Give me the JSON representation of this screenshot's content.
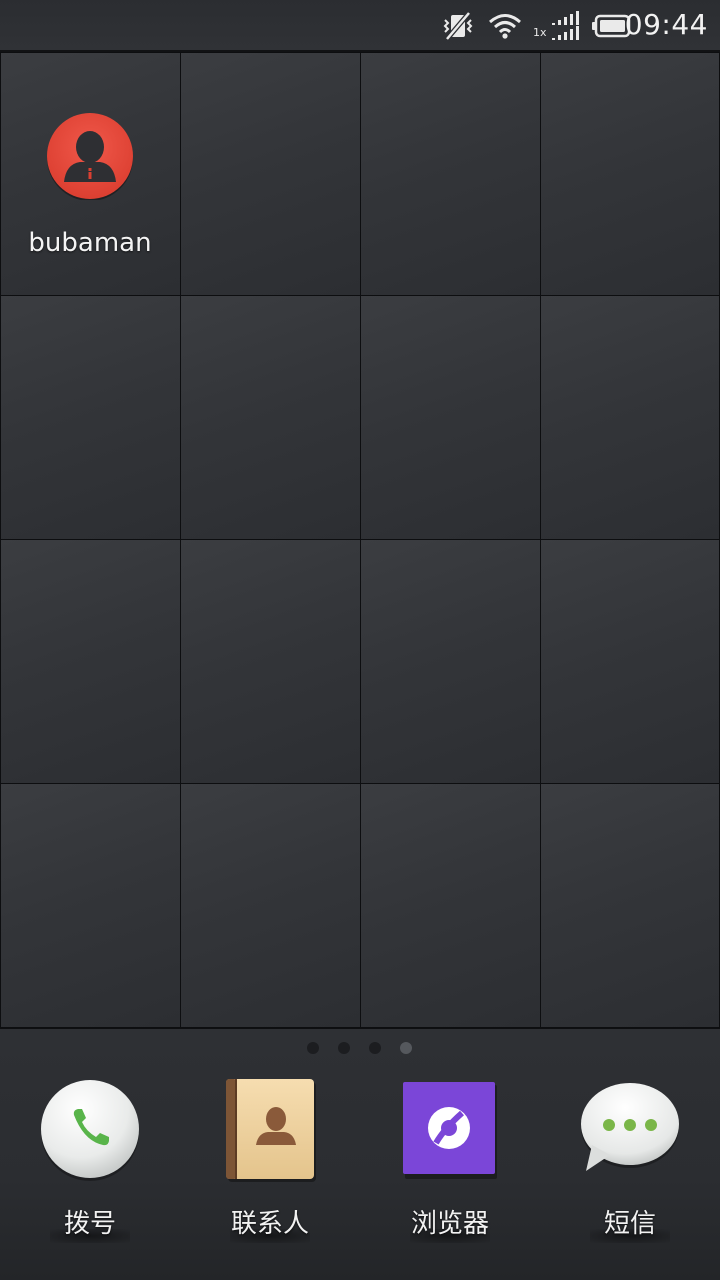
{
  "status_bar": {
    "time": "09:44",
    "icons": [
      "mute-vibrate-icon",
      "wifi-icon",
      "signal-icon",
      "battery-icon"
    ],
    "signal_label": "1x"
  },
  "home": {
    "shortcut": {
      "name": "bubaman",
      "icon": "contact-avatar-icon",
      "accent": "#e8473a"
    },
    "pages": {
      "count": 4,
      "current": 4
    }
  },
  "dock": {
    "items": [
      {
        "label": "拨号",
        "icon": "phone-icon"
      },
      {
        "label": "联系人",
        "icon": "contacts-book-icon"
      },
      {
        "label": "浏览器",
        "icon": "browser-icon",
        "accent": "#7b46d8"
      },
      {
        "label": "短信",
        "icon": "messages-icon",
        "accent": "#7ab648"
      }
    ]
  }
}
